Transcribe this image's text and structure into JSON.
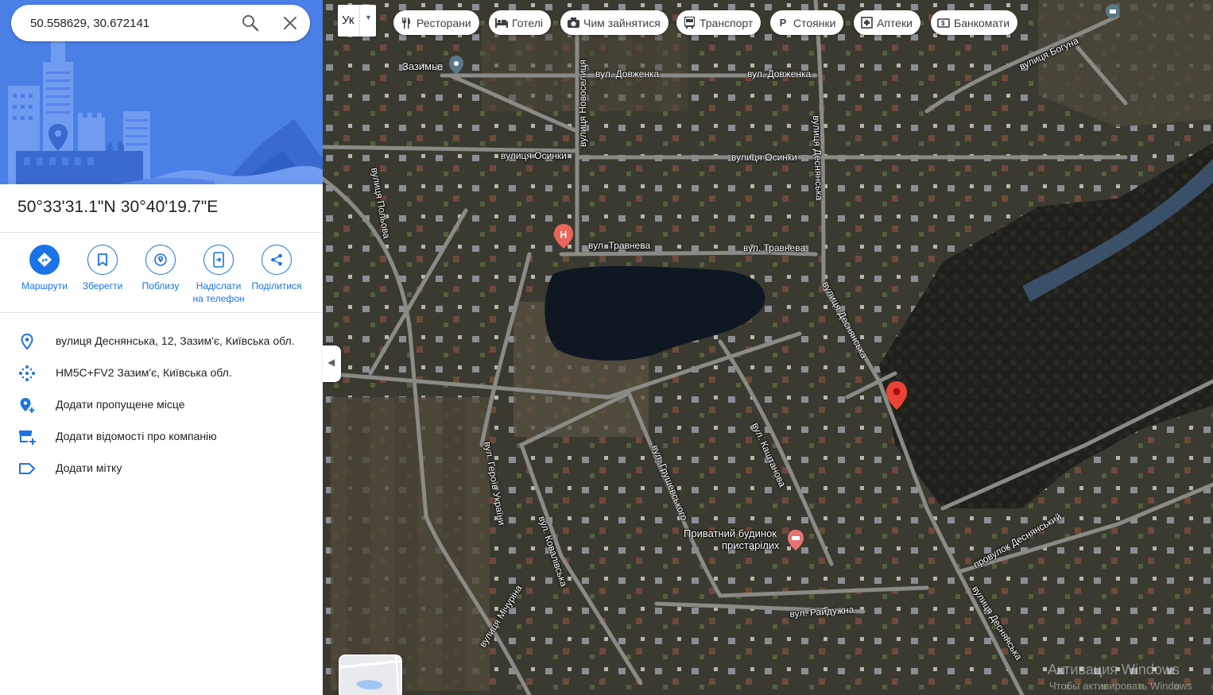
{
  "search": {
    "value": "50.558629, 30.672141"
  },
  "place": {
    "coordinates_title": "50°33'31.1\"N 30°40'19.7\"E"
  },
  "actions": [
    {
      "label": "Маршрути",
      "icon": "directions-icon"
    },
    {
      "label": "Зберегти",
      "icon": "bookmark-icon"
    },
    {
      "label": "Поблизу",
      "icon": "nearby-icon"
    },
    {
      "label_line1": "Надіслати",
      "label_line2": "на телефон",
      "icon": "send-to-phone-icon"
    },
    {
      "label": "Поділитися",
      "icon": "share-icon"
    }
  ],
  "info_rows": [
    {
      "text": "вулиця Деснянська, 12, Зазим'є, Київська обл.",
      "icon": "location-pin-icon"
    },
    {
      "text": "HM5C+FV2 Зазим'є, Київська обл.",
      "icon": "plus-code-icon"
    },
    {
      "text": "Додати пропущене місце",
      "icon": "add-place-icon"
    },
    {
      "text": "Додати відомості про компанію",
      "icon": "add-business-icon"
    },
    {
      "text": "Додати мітку",
      "icon": "label-icon"
    }
  ],
  "map": {
    "language_button": "Ук",
    "chips": [
      {
        "label": "Ресторани",
        "icon": "restaurant-icon"
      },
      {
        "label": "Готелі",
        "icon": "hotel-icon"
      },
      {
        "label": "Чим зайнятися",
        "icon": "camera-icon"
      },
      {
        "label": "Транспорт",
        "icon": "transit-icon"
      },
      {
        "label": "Стоянки",
        "icon": "parking-icon"
      },
      {
        "label": "Аптеки",
        "icon": "pharmacy-icon"
      },
      {
        "label": "Банкомати",
        "icon": "atm-icon"
      }
    ],
    "labels": [
      "Зазимье",
      "вул. Довженка",
      "вул. Довженка",
      "вулиця Новоселиця",
      "вулиця Осинки",
      "вулиця Осинки",
      "вулиця Польова",
      "вул. Травнева",
      "вул. Травнева",
      "вулиця Деснянська",
      "вулиця Деснянська",
      "вулиця Деснянська",
      "вулиця Богуна",
      "вул. Героїв України",
      "вул. Грушевського",
      "вул. Каштанова",
      "вул. Ковалівська",
      "вулиця Мічуріна",
      "вул. Райдужна",
      "провулок Деснянський",
      "Приватний будинок",
      "пристарілих"
    ],
    "colors": {
      "pin": "#ea4335",
      "hospital_marker": "#e8665a",
      "poi_marker": "#e57373"
    }
  },
  "watermark": {
    "line1": "Активация Windows",
    "line2": "Чтобы активировать Windows"
  }
}
